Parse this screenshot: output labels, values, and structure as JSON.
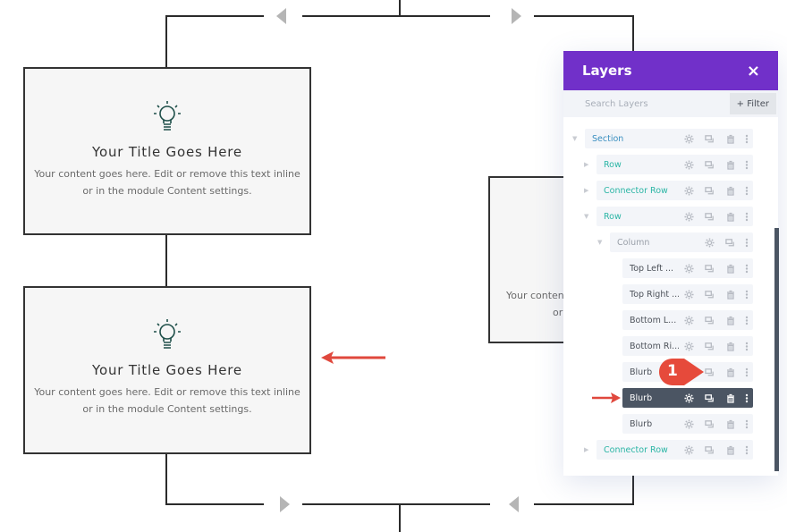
{
  "canvas": {
    "blurbs": [
      {
        "title": "Your Title Goes Here",
        "body_line1": "Your content goes here. Edit or remove this text inline",
        "body_line2": "or in the module Content settings."
      },
      {
        "title": "Your Title Goes Here",
        "body_line1": "Your content goes here. Edit or remove this text inline",
        "body_line2": "or in the module Content settings."
      }
    ],
    "partial_blurb": {
      "line1": "Your conten",
      "line2": "or"
    }
  },
  "layers_panel": {
    "title": "Layers",
    "close_icon": "×",
    "search_placeholder": "Search Layers",
    "filter_label": "+ Filter",
    "items": [
      {
        "label": "Section",
        "type": "section",
        "expanded": true
      },
      {
        "label": "Row",
        "type": "row",
        "expanded": false
      },
      {
        "label": "Connector Row",
        "type": "row",
        "expanded": false
      },
      {
        "label": "Row",
        "type": "row",
        "expanded": true
      },
      {
        "label": "Column",
        "type": "column",
        "expanded": true
      },
      {
        "label": "Top Left ...",
        "type": "module"
      },
      {
        "label": "Top Right ...",
        "type": "module"
      },
      {
        "label": "Bottom L...",
        "type": "module"
      },
      {
        "label": "Bottom Ri...",
        "type": "module"
      },
      {
        "label": "Blurb",
        "type": "module"
      },
      {
        "label": "Blurb",
        "type": "module",
        "selected": true
      },
      {
        "label": "Blurb",
        "type": "module"
      },
      {
        "label": "Connector Row",
        "type": "row",
        "expanded": false
      }
    ]
  },
  "annotation": {
    "badge_number": "1"
  },
  "colors": {
    "accent": "#7130c9",
    "teal": "#2bb5a5",
    "selected": "#4b5563",
    "annotation_red": "#e8443a"
  }
}
